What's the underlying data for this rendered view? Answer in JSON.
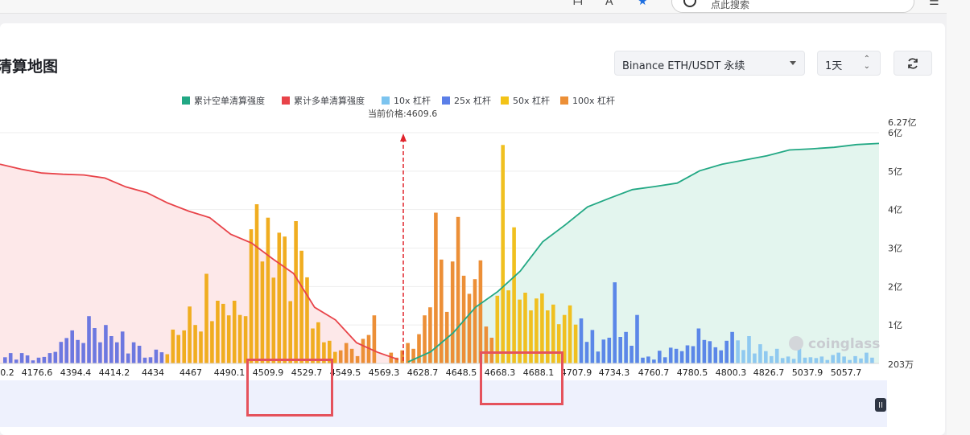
{
  "browser": {
    "toolbar_icons": [
      "translate-icon",
      "read-aloud-icon",
      "favorite-star-icon",
      "menu-icon"
    ],
    "search_placeholder": "点此搜索"
  },
  "page": {
    "title": "清算地图",
    "exchange_pair_select": "Binance ETH/USDT 永续",
    "period_select": "1天",
    "refresh_button": "refresh-icon"
  },
  "legend": [
    {
      "label": "累计空单清算强度",
      "color": "#22a884"
    },
    {
      "label": "累计多单清算强度",
      "color": "#e84349"
    },
    {
      "label": "10x 杠杆",
      "color": "#7cc4ef"
    },
    {
      "label": "25x 杠杆",
      "color": "#5b7fe8"
    },
    {
      "label": "50x 杠杆",
      "color": "#f3c317"
    },
    {
      "label": "100x 杠杆",
      "color": "#ec8f37"
    }
  ],
  "current_price_label": "当前价格:4609.6",
  "watermark": "coinglass",
  "colors": {
    "long_curve": "#e84349",
    "long_fill": "#fde8e9",
    "short_curve": "#22a884",
    "short_fill": "#e3f5ee",
    "price_line": "#e0242c",
    "highlight_box": "#e5525c"
  },
  "chart_data": {
    "type": "bar",
    "title": "",
    "current_price": 4609.6,
    "y_axis_ticks": [
      "203万",
      "1亿",
      "2亿",
      "3亿",
      "4亿",
      "5亿",
      "6亿",
      "6.27亿"
    ],
    "y_axis_unit": "亿 (1e8 USDT)",
    "ylim": [
      0.0203,
      6.27
    ],
    "x_tick_labels": [
      "0.2",
      "4176.6",
      "4394.4",
      "4414.2",
      "4434",
      "4467",
      "4490.1",
      "4509.9",
      "4529.7",
      "4549.5",
      "4569.3",
      "4628.7",
      "4648.5",
      "4668.3",
      "4688.1",
      "4707.9",
      "4734.3",
      "4760.7",
      "4780.5",
      "4800.3",
      "4826.7",
      "5037.9",
      "5057.7"
    ],
    "highlighted_ranges": [
      [
        "4509.9",
        "4529.7"
      ],
      [
        "4668.3",
        "4688.1"
      ]
    ],
    "bars_estimated": [
      0.16,
      0.27,
      0.1,
      0.27,
      0.21,
      0.08,
      0.15,
      0.17,
      0.27,
      0.3,
      0.56,
      0.66,
      0.86,
      0.61,
      0.53,
      1.23,
      0.92,
      0.55,
      1.0,
      0.71,
      0.55,
      0.83,
      0.26,
      0.55,
      0.46,
      0.15,
      0.16,
      0.36,
      0.29,
      0.24,
      0.88,
      0.74,
      0.86,
      1.48,
      1.0,
      0.83,
      2.33,
      1.1,
      1.63,
      1.55,
      1.25,
      1.63,
      1.26,
      1.23,
      3.49,
      4.14,
      2.65,
      3.79,
      2.23,
      3.4,
      3.3,
      1.62,
      3.7,
      2.93,
      2.24,
      0.91,
      1.07,
      0.55,
      0.59,
      0.3,
      0.34,
      0.53,
      0.38,
      0.19,
      0.64,
      0.74,
      1.25,
      0.28,
      0.15,
      0.34,
      0.53,
      0.38,
      0.76,
      1.25,
      1.46,
      3.92,
      2.7,
      1.34,
      2.65,
      3.81,
      2.28,
      1.81,
      2.19,
      2.68,
      0.96,
      0.67,
      1.76,
      5.68,
      1.9,
      3.54,
      1.66,
      1.84,
      1.38,
      1.69,
      1.82,
      1.38,
      1.53,
      1.02,
      1.26,
      1.51,
      1.01,
      1.17,
      0.56,
      0.87,
      0.31,
      0.62,
      0.67,
      2.11,
      0.69,
      0.82,
      0.46,
      1.26,
      0.15,
      0.18,
      0.1,
      0.33,
      0.16,
      0.41,
      0.38,
      0.32,
      0.47,
      0.45,
      0.91,
      0.61,
      0.58,
      0.42,
      0.34,
      0.59,
      0.82,
      0.6,
      0.35,
      0.71,
      0.26,
      0.5,
      0.32,
      0.19,
      0.38,
      0.14,
      0.18,
      0.12,
      0.47,
      0.15,
      0.16,
      0.14,
      0.18,
      0.09,
      0.22,
      0.28,
      0.18,
      0.09,
      0.19,
      0.13,
      0.28,
      0.15
    ],
    "long_curve_estimated": [
      5.18,
      5.05,
      4.95,
      4.92,
      4.9,
      4.82,
      4.59,
      4.44,
      4.17,
      3.96,
      3.79,
      3.36,
      3.13,
      2.72,
      2.34,
      1.46,
      1.13,
      0.54,
      0.29,
      0.1
    ],
    "short_curve_estimated": [
      0.04,
      0.3,
      0.79,
      1.46,
      1.87,
      2.4,
      3.16,
      3.6,
      4.07,
      4.3,
      4.52,
      4.6,
      4.69,
      5.01,
      5.18,
      5.29,
      5.4,
      5.55,
      5.58,
      5.62,
      5.69,
      5.72
    ]
  }
}
